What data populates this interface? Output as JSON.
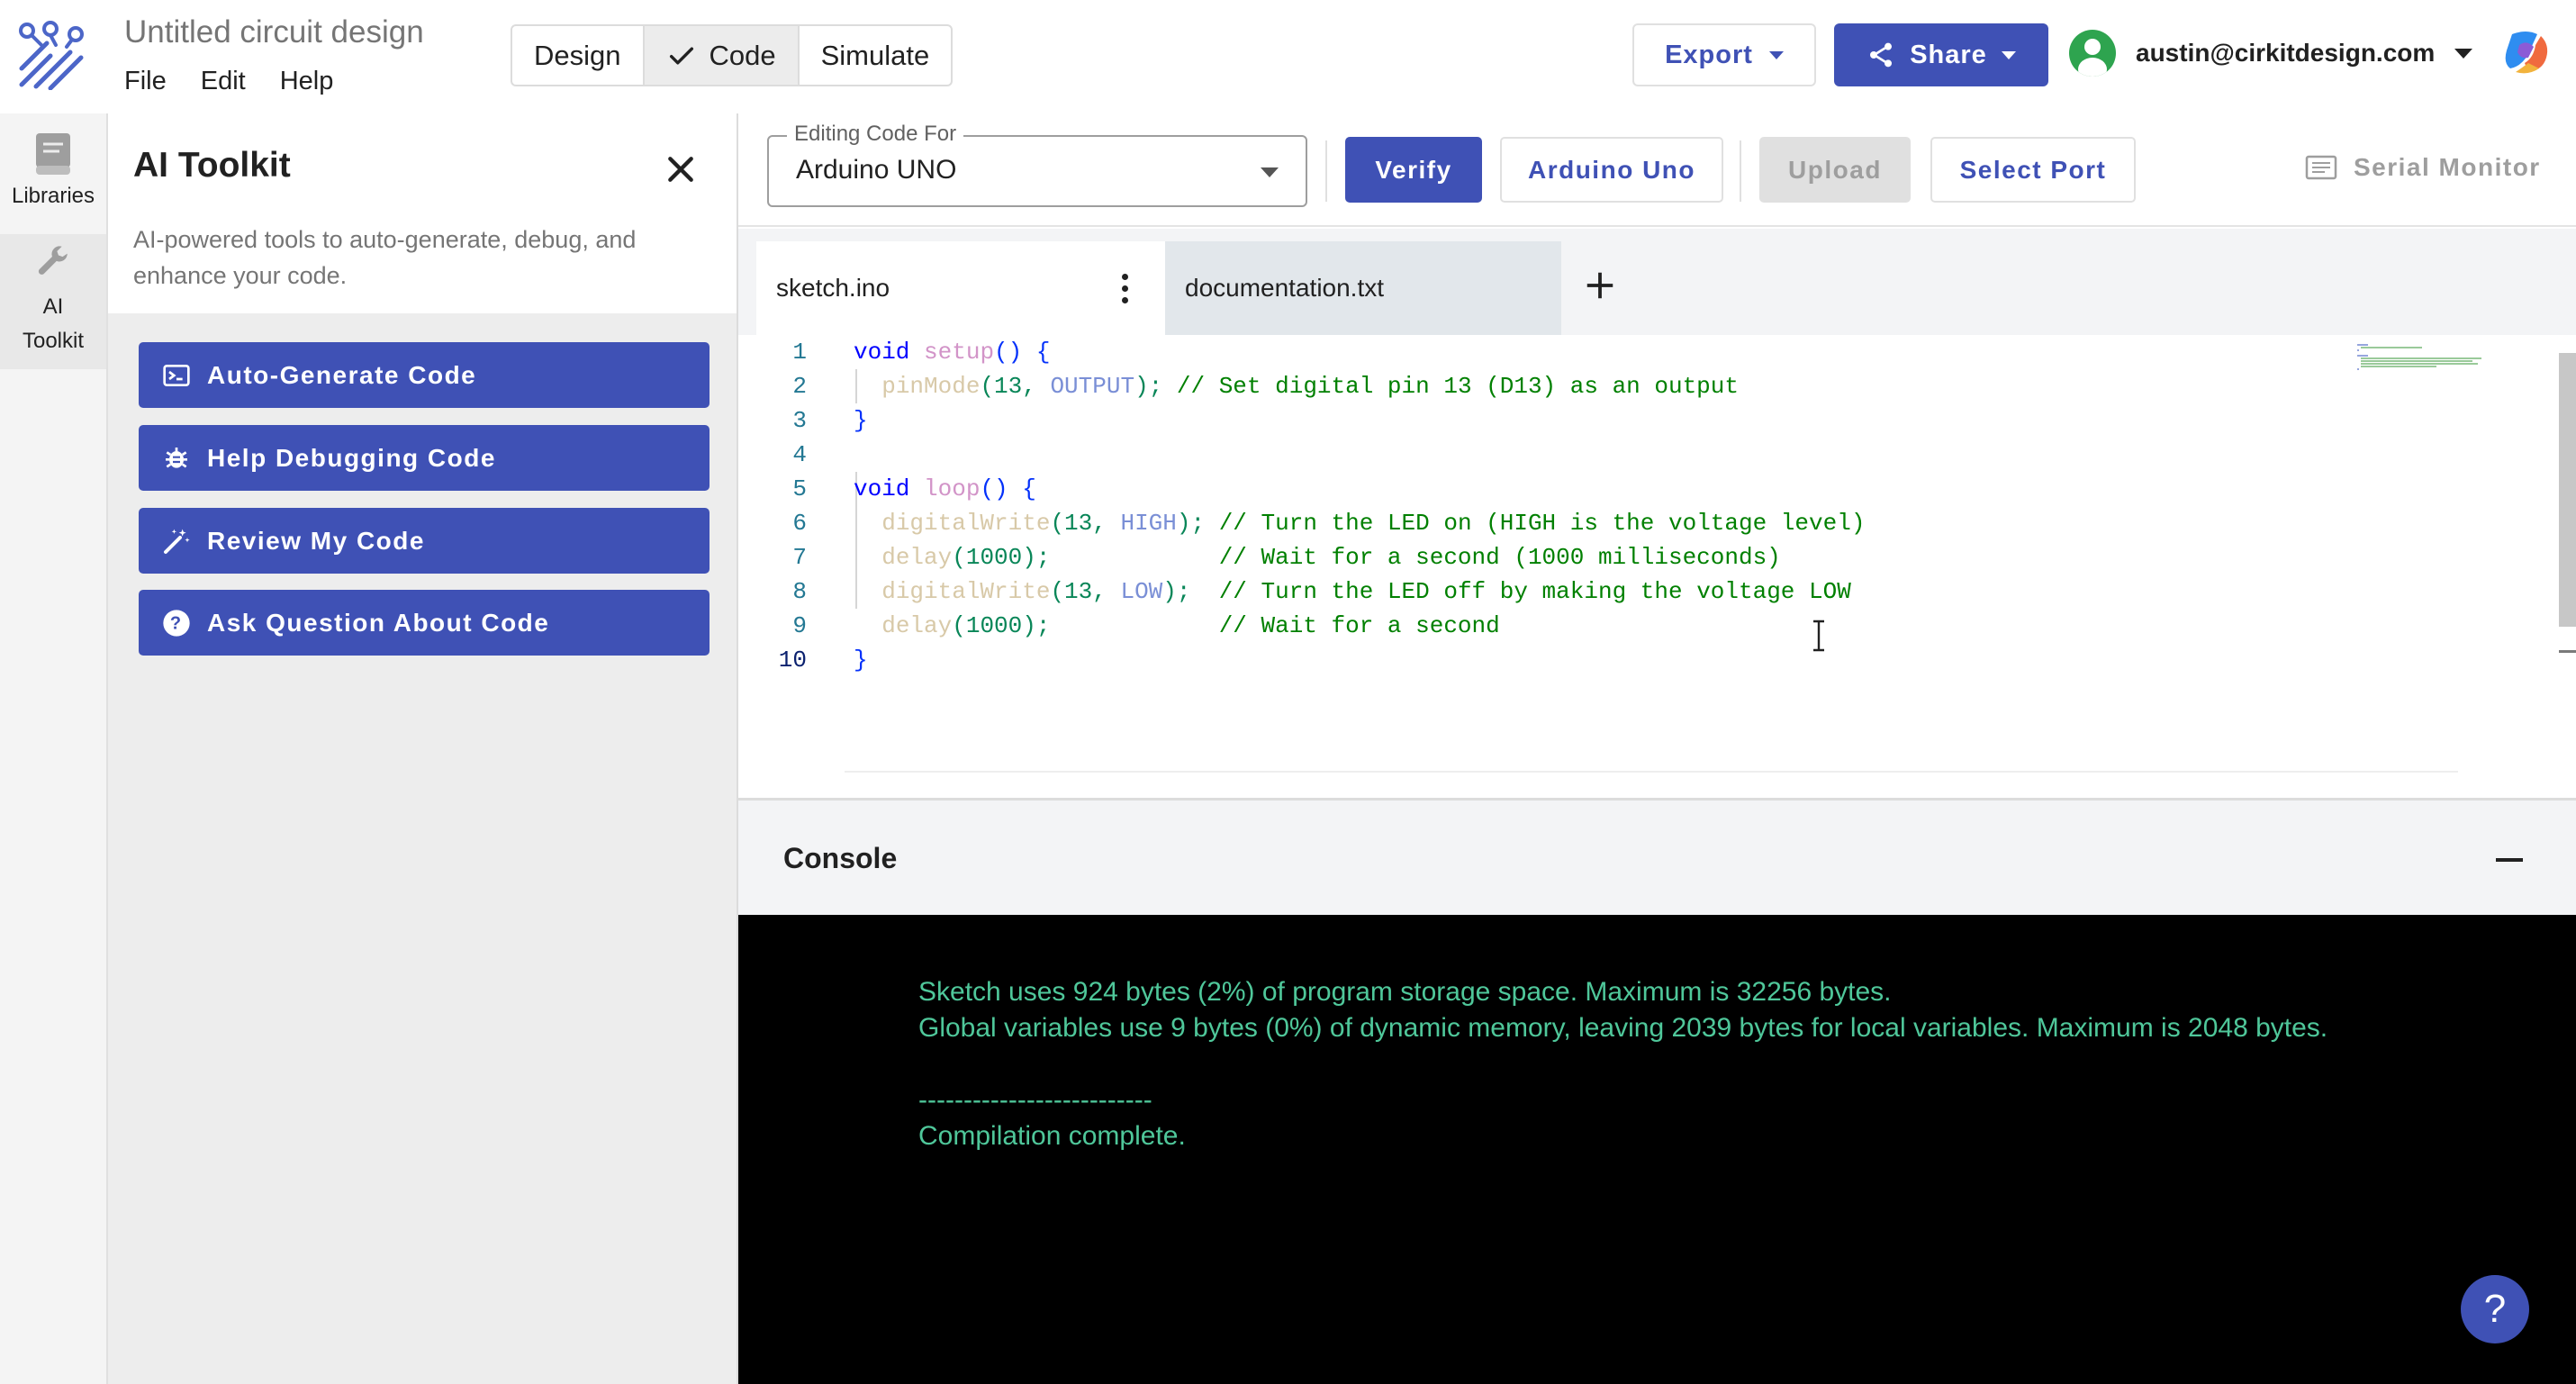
{
  "app": {
    "title": "Untitled circuit design",
    "menu": [
      "File",
      "Edit",
      "Help"
    ],
    "modes": [
      "Design",
      "Code",
      "Simulate"
    ],
    "active_mode": "Code",
    "export_label": "Export",
    "share_label": "Share",
    "user_email": "austin@cirkitdesign.com",
    "brand_color": "#3f51b5"
  },
  "rail": {
    "items": [
      {
        "label": "Libraries",
        "icon": "book-icon"
      },
      {
        "label": "AI Toolkit",
        "icon": "wrench-icon",
        "active": true
      }
    ]
  },
  "toolkit": {
    "title": "AI Toolkit",
    "description": "AI-powered tools to auto-generate, debug, and enhance your code.",
    "buttons": [
      {
        "label": "Auto-Generate Code",
        "icon": "terminal-icon"
      },
      {
        "label": "Help Debugging Code",
        "icon": "bug-icon"
      },
      {
        "label": "Review My Code",
        "icon": "magic-wand-icon"
      },
      {
        "label": "Ask Question About Code",
        "icon": "help-circle-icon"
      }
    ]
  },
  "toolbar": {
    "editing_label": "Editing Code For",
    "board_value": "Arduino UNO",
    "verify": "Verify",
    "board_button": "Arduino Uno",
    "upload": "Upload",
    "select_port": "Select Port",
    "serial_monitor": "Serial Monitor"
  },
  "tabs": [
    {
      "name": "sketch.ino",
      "active": true
    },
    {
      "name": "documentation.txt",
      "active": false
    }
  ],
  "code": {
    "line_numbers": [
      "1",
      "2",
      "3",
      "4",
      "5",
      "6",
      "7",
      "8",
      "9",
      "10"
    ],
    "current_line": 10,
    "lines": [
      [
        {
          "t": "kw",
          "v": "void"
        },
        {
          "t": "txt",
          "v": " "
        },
        {
          "t": "fn",
          "v": "setup"
        },
        {
          "t": "pu",
          "v": "() {"
        }
      ],
      [
        {
          "t": "txt",
          "v": "  "
        },
        {
          "t": "fnf",
          "v": "pinMode"
        },
        {
          "t": "num",
          "v": "(13, "
        },
        {
          "t": "cst",
          "v": "OUTPUT"
        },
        {
          "t": "num",
          "v": "); "
        },
        {
          "t": "cm",
          "v": "// Set digital pin 13 (D13) as an output"
        }
      ],
      [
        {
          "t": "pu",
          "v": "}"
        }
      ],
      [],
      [
        {
          "t": "kw",
          "v": "void"
        },
        {
          "t": "txt",
          "v": " "
        },
        {
          "t": "fn",
          "v": "loop"
        },
        {
          "t": "pu",
          "v": "() {"
        }
      ],
      [
        {
          "t": "txt",
          "v": "  "
        },
        {
          "t": "fnf",
          "v": "digitalWrite"
        },
        {
          "t": "num",
          "v": "(13, "
        },
        {
          "t": "cst",
          "v": "HIGH"
        },
        {
          "t": "num",
          "v": "); "
        },
        {
          "t": "cm",
          "v": "// Turn the LED on (HIGH is the voltage level)"
        }
      ],
      [
        {
          "t": "txt",
          "v": "  "
        },
        {
          "t": "fnf",
          "v": "delay"
        },
        {
          "t": "num",
          "v": "(1000);            "
        },
        {
          "t": "cm",
          "v": "// Wait for a second (1000 milliseconds)"
        }
      ],
      [
        {
          "t": "txt",
          "v": "  "
        },
        {
          "t": "fnf",
          "v": "digitalWrite"
        },
        {
          "t": "num",
          "v": "(13, "
        },
        {
          "t": "cst",
          "v": "LOW"
        },
        {
          "t": "num",
          "v": ");  "
        },
        {
          "t": "cm",
          "v": "// Turn the LED off by making the voltage LOW"
        }
      ],
      [
        {
          "t": "txt",
          "v": "  "
        },
        {
          "t": "fnf",
          "v": "delay"
        },
        {
          "t": "num",
          "v": "(1000);            "
        },
        {
          "t": "cm",
          "v": "// Wait for a second"
        }
      ],
      [
        {
          "t": "pu",
          "v": "}"
        }
      ]
    ]
  },
  "console": {
    "title": "Console",
    "lines": [
      "Sketch uses 924 bytes (2%) of program storage space. Maximum is 32256 bytes.",
      "Global variables use 9 bytes (0%) of dynamic memory, leaving 2039 bytes for local variables. Maximum is 2048 bytes.",
      "",
      "--------------------------",
      "Compilation complete."
    ],
    "text_color": "#4fc79a"
  },
  "help_fab": "?"
}
